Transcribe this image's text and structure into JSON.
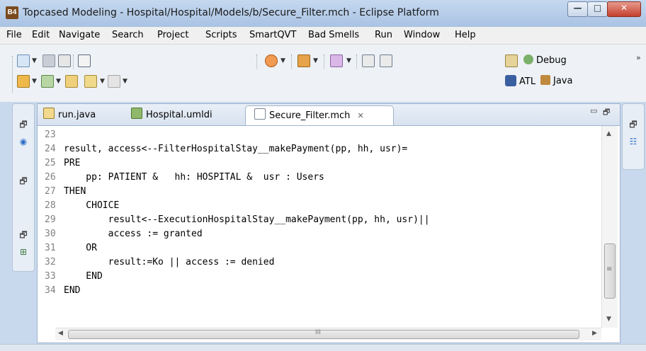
{
  "window": {
    "app_icon_text": "B4",
    "title": "Topcased Modeling - Hospital/Hospital/Models/b/Secure_Filter.mch - Eclipse Platform",
    "controls": {
      "minimize": "—",
      "maximize": "□",
      "close": "✕"
    }
  },
  "menu": [
    "File",
    "Edit",
    "Navigate",
    "Search",
    "Project",
    "Scripts",
    "SmartQVT",
    "Bad Smells",
    "Run",
    "Window",
    "Help"
  ],
  "toolbar": {
    "overflow": "»",
    "perspectives": {
      "debug": "Debug",
      "atl": "ATL",
      "java": "Java"
    }
  },
  "editor": {
    "tabs": [
      {
        "label": "run.java",
        "icon": "java-file-icon"
      },
      {
        "label": "Hospital.umldi",
        "icon": "uml-diagram-icon"
      },
      {
        "label": "Secure_Filter.mch",
        "icon": "text-file-icon",
        "active": true
      }
    ],
    "tab_close": "✕",
    "minimize": "▭",
    "maximize": "🗗",
    "lines": [
      {
        "num": "23",
        "text": ""
      },
      {
        "num": "24",
        "text": "result, access<--FilterHospitalStay__makePayment(pp, hh, usr)="
      },
      {
        "num": "25",
        "text": "PRE"
      },
      {
        "num": "26",
        "text": "    pp: PATIENT &   hh: HOSPITAL &  usr : Users"
      },
      {
        "num": "27",
        "text": "THEN"
      },
      {
        "num": "28",
        "text": "    CHOICE"
      },
      {
        "num": "29",
        "text": "        result<--ExecutionHospitalStay__makePayment(pp, hh, usr)||"
      },
      {
        "num": "30",
        "text": "        access := granted"
      },
      {
        "num": "31",
        "text": "    OR"
      },
      {
        "num": "32",
        "text": "        result:=Ko || access := denied"
      },
      {
        "num": "33",
        "text": "    END"
      },
      {
        "num": "34",
        "text": "END"
      }
    ],
    "scroll": {
      "up": "▲",
      "down": "▼",
      "left": "◀",
      "right": "▶",
      "grip": "≡",
      "hgrip": "III"
    }
  }
}
